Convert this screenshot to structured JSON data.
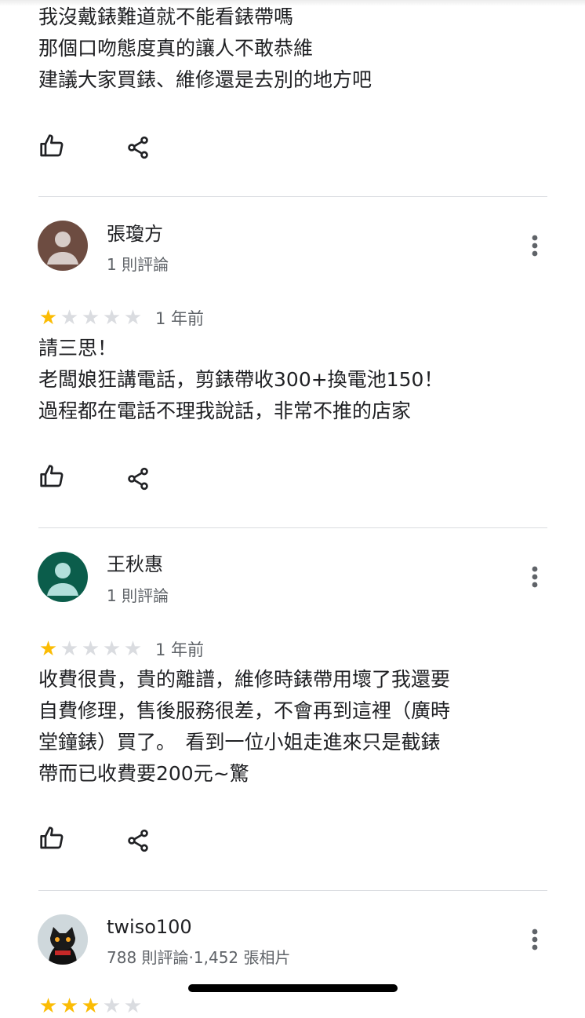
{
  "review0": {
    "lines": [
      "我沒戴錶難道就不能看錶帶嗎",
      "那個口吻態度真的讓人不敢恭維",
      "建議大家買錶、維修還是去別的地方吧"
    ]
  },
  "review1": {
    "author": "張瓊方",
    "meta": "1 則評論",
    "rating": 1,
    "time": "1 年前",
    "lines": [
      "請三思！",
      "老闆娘狂講電話，剪錶帶收300+換電池150！",
      "過程都在電話不理我說話，非常不推的店家"
    ],
    "avatar_color": "#6d4c41"
  },
  "review2": {
    "author": "王秋惠",
    "meta": "1 則評論",
    "rating": 1,
    "time": "1 年前",
    "lines": [
      "收費很貴，貴的離譜，維修時錶帶用壞了我還要",
      "自費修理，售後服務很差，不會再到這裡（廣時",
      "堂鐘錶）買了。　看到一位小姐走進來只是截錶",
      "帶而已收費要200元~驚"
    ],
    "avatar_color": "#0b5d4b"
  },
  "review3": {
    "author": "twiso100",
    "meta": "788 則評論·1,452 張相片"
  },
  "colors": {
    "star_on": "#fbbc04",
    "star_off": "#dadce0",
    "divider": "#dadce0"
  },
  "icons": {
    "like": "thumb-up-icon",
    "share": "share-icon",
    "more": "more-vert-icon"
  }
}
